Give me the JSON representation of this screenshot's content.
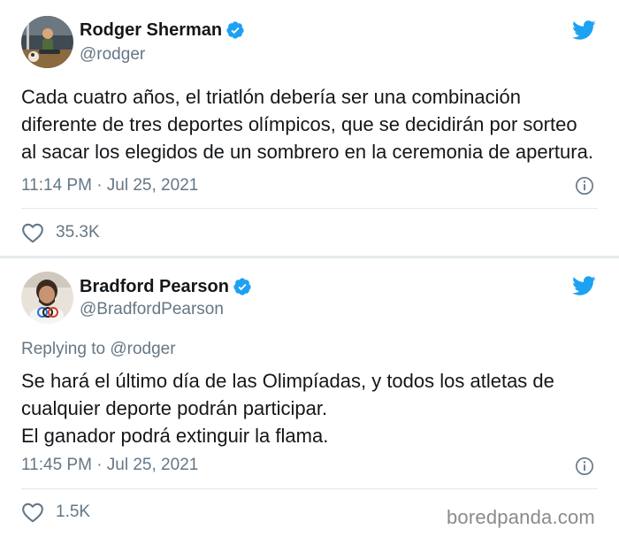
{
  "tweets": [
    {
      "display_name": "Rodger Sherman",
      "handle": "@rodger",
      "text_lines": [
        "Cada cuatro años, el triatlón debería ser una combinación",
        "diferente de tres deportes olímpicos, que se decidirán por sorteo",
        "al sacar los elegidos de un sombrero en la ceremonia de apertura."
      ],
      "timestamp": "11:14 PM · Jul 25, 2021",
      "likes": "35.3K"
    },
    {
      "display_name": "Bradford Pearson",
      "handle": "@BradfordPearson",
      "replying_to": "Replying to @rodger",
      "text_lines": [
        "Se hará el último día de las Olimpíadas, y todos los atletas de",
        "cualquier deporte podrán participar.",
        "El ganador podrá extinguir la flama."
      ],
      "timestamp": "11:45 PM · Jul 25, 2021",
      "likes": "1.5K"
    }
  ],
  "watermark": "boredpanda.com",
  "icons": {
    "verified": "verified-badge-icon",
    "bird": "twitter-bird-icon",
    "info": "info-icon",
    "heart": "heart-icon"
  },
  "colors": {
    "twitter_blue": "#1da1f2",
    "secondary_text": "#657786",
    "primary_text": "#14171a"
  }
}
